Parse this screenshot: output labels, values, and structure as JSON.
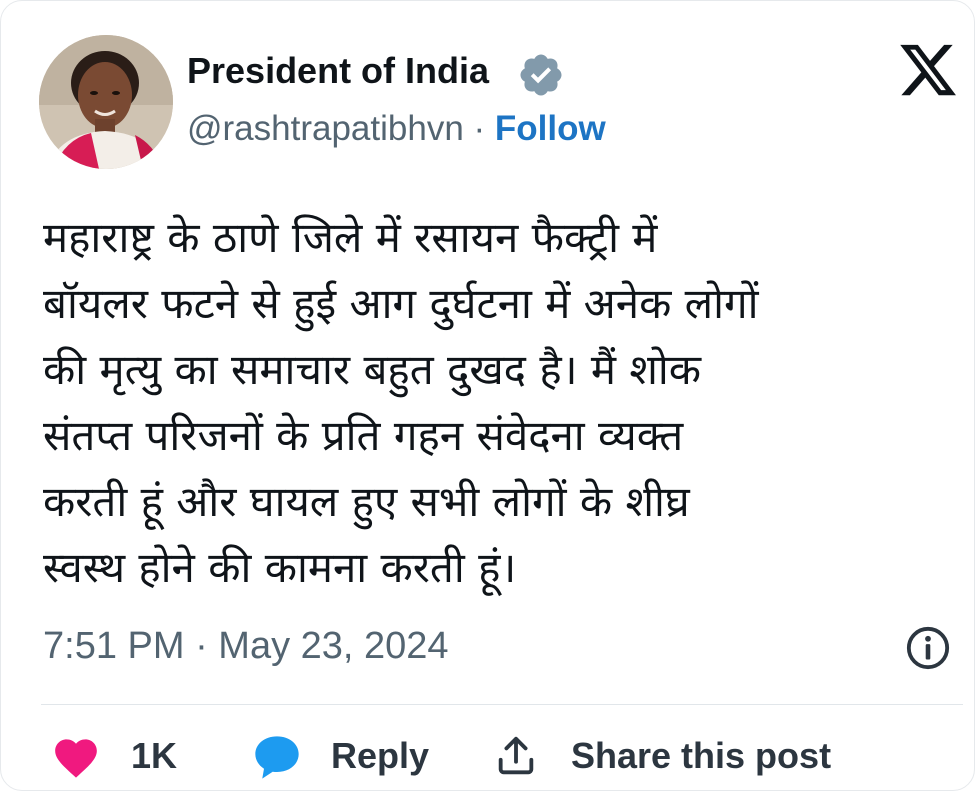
{
  "author": {
    "display_name": "President of India",
    "handle": "@rashtrapatibhvn",
    "separator": "·",
    "follow_label": "Follow",
    "verified": true
  },
  "tweet": {
    "text": "महाराष्ट्र के ठाणे जिले में रसायन फैक्ट्री में\nबॉयलर फटने से हुई आग दुर्घटना में अनेक लोगों\nकी मृत्यु का समाचार बहुत दुखद है। मैं शोक\nसंतप्त परिजनों के प्रति गहन संवेदना व्यक्त\nकरती हूं और घायल हुए सभी लोगों के शीघ्र\nस्वस्थ होने की कामना करती हूं।",
    "timestamp": "7:51 PM · May 23, 2024"
  },
  "actions": {
    "like_count": "1K",
    "reply_label": "Reply",
    "share_label": "Share this post"
  },
  "icons": {
    "verified": "verified-badge-icon",
    "platform": "x-logo-icon",
    "info": "info-icon",
    "like": "heart-icon",
    "reply": "speech-bubble-icon",
    "share": "share-icon"
  },
  "colors": {
    "follow": "#1d74c4",
    "verified_badge": "#829aab",
    "like": "#f0197f",
    "reply": "#1d9bf0",
    "secondary_text": "#536471"
  }
}
